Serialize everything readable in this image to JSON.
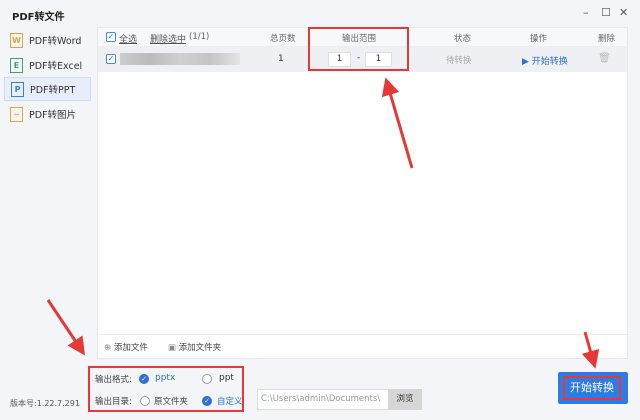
{
  "window": {
    "title": "PDF转文件"
  },
  "sidebar": {
    "items": [
      {
        "label": "PDF转Word",
        "icon": "W",
        "color": "#e8a33b"
      },
      {
        "label": "PDF转Excel",
        "icon": "E",
        "color": "#3aa66b"
      },
      {
        "label": "PDF转PPT",
        "icon": "P",
        "color": "#3e7fd0",
        "selected": true
      },
      {
        "label": "PDF转图片",
        "icon": "~",
        "color": "#e8a33b"
      }
    ]
  },
  "table": {
    "select_all": "全选",
    "delete_selected": "删除选中",
    "count": "(1/1)",
    "columns": {
      "pages": "总页数",
      "range": "输出范围",
      "status": "状态",
      "action": "操作",
      "delete": "删除"
    },
    "rows": [
      {
        "pages": "1",
        "range_from": "1",
        "range_sep": "-",
        "range_to": "1",
        "status": "待转换",
        "action": "开始转换"
      }
    ]
  },
  "add": {
    "file": "添加文件",
    "folder": "添加文件夹"
  },
  "output": {
    "format_label": "输出格式:",
    "format_options": [
      "pptx",
      "ppt"
    ],
    "dir_label": "输出目录:",
    "dir_options": [
      "原文件夹",
      "自定义"
    ],
    "path": "C:\\Users\\admin\\Documents\\",
    "browse": "浏览"
  },
  "start_button": "开始转换",
  "version": "版本号:1.22.7.291"
}
